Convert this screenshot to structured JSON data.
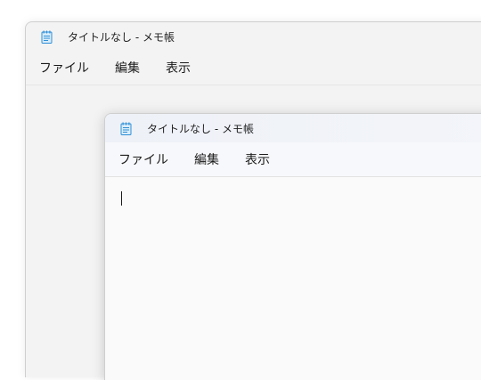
{
  "back_window": {
    "title": "タイトルなし - メモ帳",
    "menu": [
      "ファイル",
      "編集",
      "表示"
    ]
  },
  "front_window": {
    "title": "タイトルなし - メモ帳",
    "menu": [
      "ファイル",
      "編集",
      "表示"
    ],
    "editor_text": ""
  },
  "colors": {
    "icon_blue": "#2f8fd6",
    "icon_body": "#d8ecfa"
  },
  "icons": {
    "app_icon": "notepad-icon"
  }
}
